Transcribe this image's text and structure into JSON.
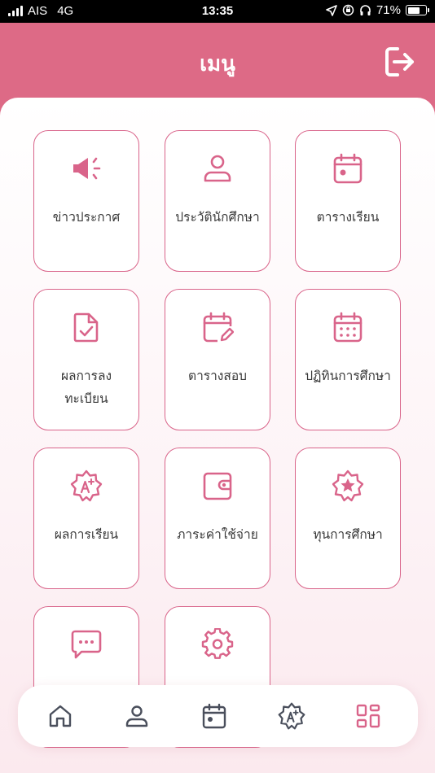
{
  "status_bar": {
    "carrier": "AIS",
    "network": "4G",
    "time": "13:35",
    "battery": "71%",
    "battery_level": 0.71
  },
  "header": {
    "title": "เมนู"
  },
  "colors": {
    "brand": "#dd6a86",
    "tile_border": "#d9648a",
    "icon": "#d9648a",
    "nav_icon": "#4a4f5c"
  },
  "menu": {
    "items": [
      {
        "label": "ข่าวประกาศ",
        "icon": "megaphone-icon"
      },
      {
        "label": "ประวัตินักศึกษา",
        "icon": "user-icon"
      },
      {
        "label": "ตารางเรียน",
        "icon": "calendar-day-icon"
      },
      {
        "label": "ผลการลง",
        "label2": "ทะเบียน",
        "icon": "document-check-icon"
      },
      {
        "label": "ตารางสอบ",
        "icon": "calendar-edit-icon"
      },
      {
        "label": "ปฏิทินการศึกษา",
        "icon": "calendar-grid-icon"
      },
      {
        "label": "ผลการเรียน",
        "icon": "grade-badge-icon"
      },
      {
        "label": "ภาระค่าใช้จ่าย",
        "icon": "wallet-icon"
      },
      {
        "label": "ทุนการศึกษา",
        "icon": "star-badge-icon"
      },
      {
        "label": "",
        "icon": "chat-icon"
      },
      {
        "label": "",
        "icon": "gear-icon"
      }
    ]
  },
  "bottom_nav": {
    "items": [
      {
        "icon": "home-icon"
      },
      {
        "icon": "profile-icon"
      },
      {
        "icon": "calendar-icon"
      },
      {
        "icon": "grade-icon"
      },
      {
        "icon": "apps-grid-icon",
        "active": true
      }
    ]
  }
}
